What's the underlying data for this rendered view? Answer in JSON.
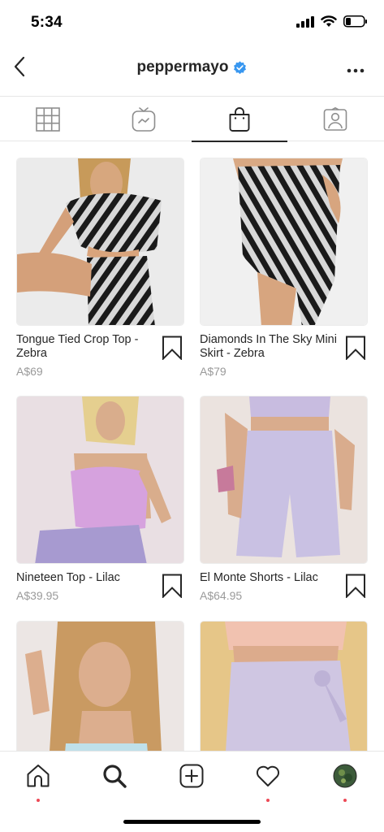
{
  "status_bar": {
    "time": "5:34"
  },
  "header": {
    "username": "peppermayo",
    "verified": true
  },
  "tabs": [
    {
      "name": "grid",
      "icon": "grid-icon",
      "active": false
    },
    {
      "name": "igtv",
      "icon": "igtv-icon",
      "active": false
    },
    {
      "name": "shop",
      "icon": "shopping-bag-icon",
      "active": true
    },
    {
      "name": "tagged",
      "icon": "tagged-person-icon",
      "active": false
    }
  ],
  "products": [
    {
      "name": "Tongue Tied Crop Top - Zebra",
      "price": "A$69"
    },
    {
      "name": "Diamonds In The Sky Mini Skirt - Zebra",
      "price": "A$79"
    },
    {
      "name": "Nineteen Top - Lilac",
      "price": "A$39.95"
    },
    {
      "name": "El Monte Shorts - Lilac",
      "price": "A$64.95"
    },
    {
      "name": "",
      "price": ""
    },
    {
      "name": "",
      "price": ""
    }
  ],
  "bottom_nav": [
    {
      "name": "home",
      "icon": "home-icon",
      "notification": true
    },
    {
      "name": "search",
      "icon": "search-icon",
      "notification": false
    },
    {
      "name": "new-post",
      "icon": "plus-square-icon",
      "notification": false
    },
    {
      "name": "activity",
      "icon": "heart-icon",
      "notification": true
    },
    {
      "name": "profile",
      "icon": "avatar",
      "notification": true
    }
  ],
  "colors": {
    "verified": "#3897f0",
    "notification_dot": "#ed4956",
    "text": "#262626",
    "muted": "#9a9a9a"
  }
}
